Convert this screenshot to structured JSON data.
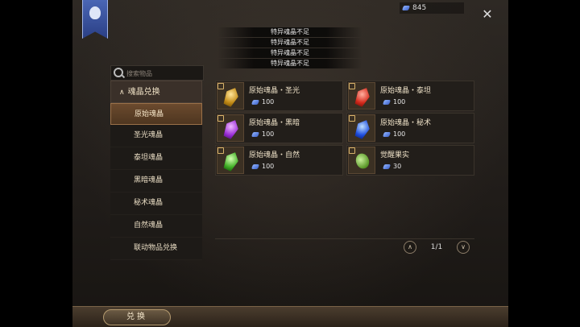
{
  "currency": {
    "amount": "845",
    "icon": "soul-crystal-icon"
  },
  "toasts": [
    "特异魂晶不足",
    "特异魂晶不足",
    "特异魂晶不足",
    "特异魂晶不足"
  ],
  "search": {
    "placeholder": "搜索物品"
  },
  "sidebar": {
    "category": "魂晶兑换",
    "items": [
      {
        "label": "原始魂晶",
        "selected": true
      },
      {
        "label": "圣光魂晶"
      },
      {
        "label": "泰坦魂晶"
      },
      {
        "label": "黑暗魂晶"
      },
      {
        "label": "秘术魂晶"
      },
      {
        "label": "自然魂晶"
      },
      {
        "label": "联动物品兑换"
      }
    ]
  },
  "items": [
    {
      "name": "原始魂晶・圣光",
      "price": "100",
      "color": "#c28a15"
    },
    {
      "name": "原始魂晶・泰坦",
      "price": "100",
      "color": "#d52a1c"
    },
    {
      "name": "原始魂晶・黑暗",
      "price": "100",
      "color": "#9b2fd6"
    },
    {
      "name": "原始魂晶・秘术",
      "price": "100",
      "color": "#1f4fe0"
    },
    {
      "name": "原始魂晶・自然",
      "price": "100",
      "color": "#3fae25"
    },
    {
      "name": "觉醒果实",
      "price": "30",
      "color": "#5d9a2b"
    }
  ],
  "pager": {
    "text": "1/1"
  },
  "bottom": {
    "tab_label": "兑换"
  }
}
